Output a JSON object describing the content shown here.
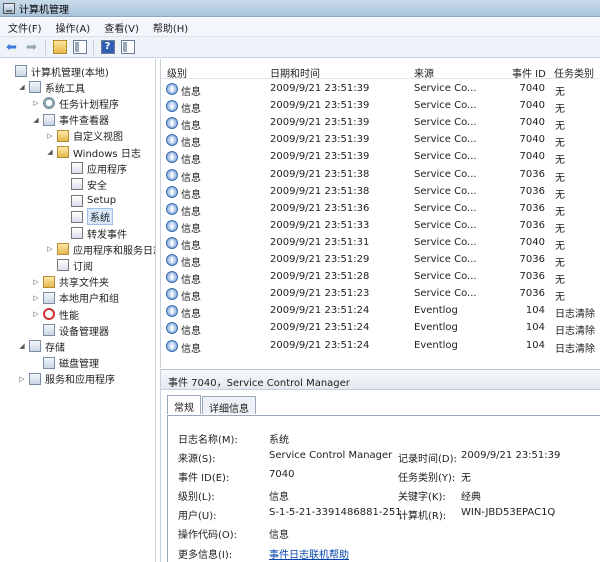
{
  "window": {
    "title": "计算机管理"
  },
  "menu": [
    "文件(F)",
    "操作(A)",
    "查看(V)",
    "帮助(H)"
  ],
  "toolbar": {
    "back_icon": "back-arrow-icon",
    "forward_icon": "forward-arrow-icon",
    "up_icon": "up-folder-icon",
    "panel_icon": "show-hide-tree-icon",
    "help_label": "?",
    "help_icon": "help-icon",
    "pane_icon": "show-hide-action-pane-icon"
  },
  "tree": [
    {
      "label": "计算机管理(本地)",
      "depth": 0,
      "exp": "",
      "icon": "computer-icon",
      "cls": ""
    },
    {
      "label": "系统工具",
      "depth": 1,
      "exp": "◢",
      "icon": "tools-icon",
      "cls": ""
    },
    {
      "label": "任务计划程序",
      "depth": 2,
      "exp": "▷",
      "icon": "clock-icon",
      "cls": "clock"
    },
    {
      "label": "事件查看器",
      "depth": 2,
      "exp": "◢",
      "icon": "event-viewer-icon",
      "cls": ""
    },
    {
      "label": "自定义视图",
      "depth": 3,
      "exp": "▷",
      "icon": "folder-icon",
      "cls": "folder"
    },
    {
      "label": "Windows 日志",
      "depth": 3,
      "exp": "◢",
      "icon": "folder-icon",
      "cls": "folder"
    },
    {
      "label": "应用程序",
      "depth": 4,
      "exp": "",
      "icon": "log-icon",
      "cls": "log"
    },
    {
      "label": "安全",
      "depth": 4,
      "exp": "",
      "icon": "log-icon",
      "cls": "log"
    },
    {
      "label": "Setup",
      "depth": 4,
      "exp": "",
      "icon": "log-icon",
      "cls": "log"
    },
    {
      "label": "系统",
      "depth": 4,
      "exp": "",
      "icon": "log-icon",
      "cls": "log",
      "selected": true
    },
    {
      "label": "转发事件",
      "depth": 4,
      "exp": "",
      "icon": "log-icon",
      "cls": "log"
    },
    {
      "label": "应用程序和服务日志",
      "depth": 3,
      "exp": "▷",
      "icon": "folder-icon",
      "cls": "folder"
    },
    {
      "label": "订阅",
      "depth": 3,
      "exp": "",
      "icon": "subscription-icon",
      "cls": "log"
    },
    {
      "label": "共享文件夹",
      "depth": 2,
      "exp": "▷",
      "icon": "shared-folder-icon",
      "cls": "folder"
    },
    {
      "label": "本地用户和组",
      "depth": 2,
      "exp": "▷",
      "icon": "users-icon",
      "cls": ""
    },
    {
      "label": "性能",
      "depth": 2,
      "exp": "▷",
      "icon": "performance-icon",
      "cls": "noentry"
    },
    {
      "label": "设备管理器",
      "depth": 2,
      "exp": "",
      "icon": "device-manager-icon",
      "cls": ""
    },
    {
      "label": "存储",
      "depth": 1,
      "exp": "◢",
      "icon": "storage-icon",
      "cls": ""
    },
    {
      "label": "磁盘管理",
      "depth": 2,
      "exp": "",
      "icon": "disk-icon",
      "cls": ""
    },
    {
      "label": "服务和应用程序",
      "depth": 1,
      "exp": "▷",
      "icon": "services-icon",
      "cls": ""
    }
  ],
  "columns": [
    "级别",
    "日期和时间",
    "来源",
    "事件 ID",
    "任务类别"
  ],
  "events": [
    {
      "level": "信息",
      "datetime": "2009/9/21 23:51:39",
      "source": "Service Co...",
      "id": "7040",
      "category": "无"
    },
    {
      "level": "信息",
      "datetime": "2009/9/21 23:51:39",
      "source": "Service Co...",
      "id": "7040",
      "category": "无"
    },
    {
      "level": "信息",
      "datetime": "2009/9/21 23:51:39",
      "source": "Service Co...",
      "id": "7040",
      "category": "无"
    },
    {
      "level": "信息",
      "datetime": "2009/9/21 23:51:39",
      "source": "Service Co...",
      "id": "7040",
      "category": "无"
    },
    {
      "level": "信息",
      "datetime": "2009/9/21 23:51:39",
      "source": "Service Co...",
      "id": "7040",
      "category": "无"
    },
    {
      "level": "信息",
      "datetime": "2009/9/21 23:51:38",
      "source": "Service Co...",
      "id": "7036",
      "category": "无"
    },
    {
      "level": "信息",
      "datetime": "2009/9/21 23:51:38",
      "source": "Service Co...",
      "id": "7036",
      "category": "无"
    },
    {
      "level": "信息",
      "datetime": "2009/9/21 23:51:36",
      "source": "Service Co...",
      "id": "7036",
      "category": "无"
    },
    {
      "level": "信息",
      "datetime": "2009/9/21 23:51:33",
      "source": "Service Co...",
      "id": "7036",
      "category": "无"
    },
    {
      "level": "信息",
      "datetime": "2009/9/21 23:51:31",
      "source": "Service Co...",
      "id": "7040",
      "category": "无"
    },
    {
      "level": "信息",
      "datetime": "2009/9/21 23:51:29",
      "source": "Service Co...",
      "id": "7036",
      "category": "无"
    },
    {
      "level": "信息",
      "datetime": "2009/9/21 23:51:28",
      "source": "Service Co...",
      "id": "7036",
      "category": "无"
    },
    {
      "level": "信息",
      "datetime": "2009/9/21 23:51:23",
      "source": "Service Co...",
      "id": "7036",
      "category": "无"
    },
    {
      "level": "信息",
      "datetime": "2009/9/21 23:51:24",
      "source": "Eventlog",
      "id": "104",
      "category": "日志清除"
    },
    {
      "level": "信息",
      "datetime": "2009/9/21 23:51:24",
      "source": "Eventlog",
      "id": "104",
      "category": "日志清除"
    },
    {
      "level": "信息",
      "datetime": "2009/9/21 23:51:24",
      "source": "Eventlog",
      "id": "104",
      "category": "日志清除"
    }
  ],
  "details": {
    "title": "事件 7040，Service Control Manager",
    "tabs": [
      "常规",
      "详细信息"
    ],
    "log_name_label": "日志名称(M):",
    "log_name": "系统",
    "source_label": "来源(S):",
    "source": "Service Control Manager",
    "logged_label": "记录时间(D):",
    "logged": "2009/9/21 23:51:39",
    "event_id_label": "事件 ID(E):",
    "event_id": "7040",
    "task_label": "任务类别(Y):",
    "task": "无",
    "level_label": "级别(L):",
    "level": "信息",
    "keywords_label": "关键字(K):",
    "keywords": "经典",
    "user_label": "用户(U):",
    "user": "S-1-5-21-3391486881-251",
    "computer_label": "计算机(R):",
    "computer": "WIN-JBD53EPAC1Q",
    "opcode_label": "操作代码(O):",
    "opcode": "信息",
    "more_label": "更多信息(I):",
    "more_link": "事件日志联机帮助"
  }
}
